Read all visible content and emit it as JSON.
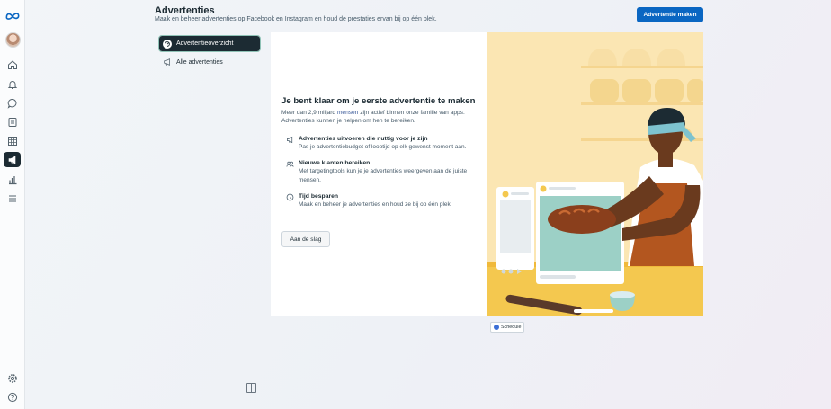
{
  "header": {
    "title": "Advertenties",
    "subtitle": "Maak en beheer advertenties op Facebook en Instagram en houd de prestaties ervan bij op één plek.",
    "create_button": "Advertentie maken"
  },
  "sidebar_nav": {
    "items": [
      {
        "label": "Advertentieoverzicht",
        "active": true
      },
      {
        "label": "Alle advertenties",
        "active": false
      }
    ]
  },
  "left_rail": {
    "icons": [
      "meta-logo-icon",
      "avatar",
      "home-icon",
      "bell-icon",
      "chat-icon",
      "pages-icon",
      "table-icon",
      "megaphone-icon",
      "bar-chart-icon",
      "menu-icon",
      "settings-icon",
      "help-icon"
    ]
  },
  "card": {
    "headline": "Je bent klaar om je eerste advertentie te maken",
    "lead_before": "Meer dan 2,9 miljard ",
    "lead_link": "mensen",
    "lead_after": " zijn actief binnen onze familie van apps. Advertenties kunnen je helpen om hen te bereiken.",
    "features": [
      {
        "icon": "megaphone-icon",
        "title": "Advertenties uitvoeren die nuttig voor je zijn",
        "desc": "Pas je advertentiebudget of looptijd op elk gewenst moment aan."
      },
      {
        "icon": "people-icon",
        "title": "Nieuwe klanten bereiken",
        "desc": "Met targetingtools kun je je advertenties weergeven aan de juiste mensen."
      },
      {
        "icon": "clock-icon",
        "title": "Tijd besparen",
        "desc": "Maak en beheer je advertenties en houd ze bij op één plek."
      }
    ],
    "start_button": "Aan de slag"
  },
  "badge": {
    "label": "Schedule"
  },
  "colors": {
    "accent": "#0a66c2",
    "dark": "#1c2b33",
    "illustration_bg": "#fbe6b3"
  }
}
